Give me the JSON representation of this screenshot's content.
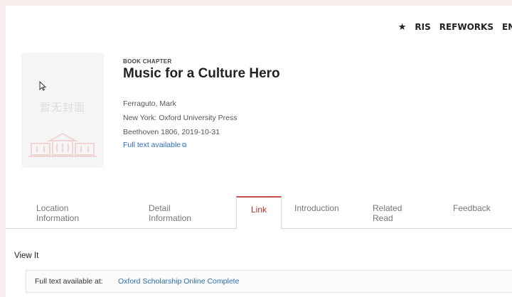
{
  "toolbar": {
    "star_icon": "star-icon",
    "ris_label": "RIS",
    "refworks_label": "REFWORKS",
    "cut_label": "EN"
  },
  "cover": {
    "placeholder_text": "暂无封面",
    "cursor_icon": "cursor-icon",
    "emblem_icon": "library-building-icon"
  },
  "record": {
    "type_label": "BOOK CHAPTER",
    "title": "Music for a Culture Hero",
    "author": "Ferraguto, Mark",
    "publisher": "New York: Oxford University Press",
    "source": "Beethoven 1806, 2019-10-31",
    "fulltext_link": "Full text available",
    "external_icon": "external-link-icon"
  },
  "tabs": [
    {
      "label": "Location\nInformation"
    },
    {
      "label": "Detail\nInformation"
    },
    {
      "label": "Link",
      "active": true
    },
    {
      "label": "Introduction"
    },
    {
      "label": "Related\nRead"
    },
    {
      "label": "Feedback"
    }
  ],
  "view_it": {
    "heading": "View It",
    "row_label": "Full text available at:",
    "row_link": "Oxford Scholarship Online Complete"
  },
  "colors": {
    "accent": "#c0504d",
    "link": "#2a6db2"
  }
}
